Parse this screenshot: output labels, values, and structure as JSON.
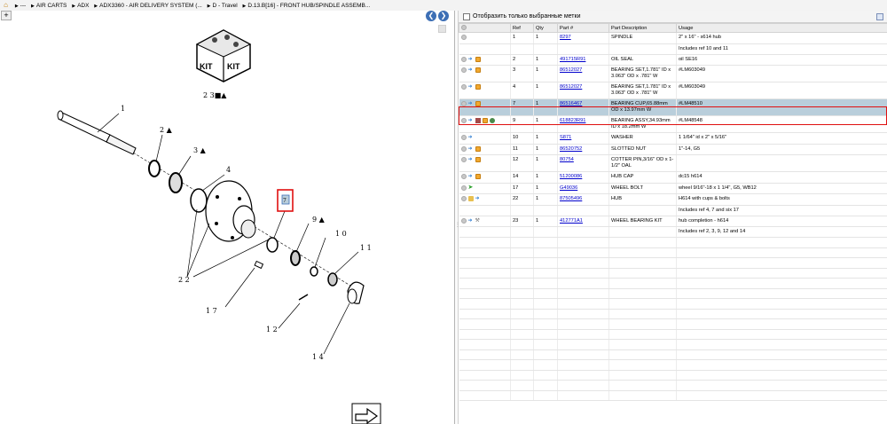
{
  "breadcrumb": {
    "items": [
      "---",
      "AIR CARTS",
      "ADX",
      "ADX3360 - AIR DELIVERY SYSTEM (...",
      "D - Travel",
      "D.13.B[16] - FRONT HUB/SPINDLE ASSEMB..."
    ]
  },
  "drawing": {
    "kit_label_1": "KIT",
    "kit_label_2": "KIT",
    "callouts": [
      {
        "id": "c23",
        "text": "2 3■▲"
      },
      {
        "id": "c1",
        "text": "1"
      },
      {
        "id": "c2",
        "text": "2 ▲"
      },
      {
        "id": "c3",
        "text": "3 ▲"
      },
      {
        "id": "c4",
        "text": "4"
      },
      {
        "id": "c7",
        "text": "7"
      },
      {
        "id": "c9",
        "text": "9 ▲"
      },
      {
        "id": "c10",
        "text": "1 0"
      },
      {
        "id": "c11",
        "text": "1 1"
      },
      {
        "id": "c22",
        "text": "2 2"
      },
      {
        "id": "c17",
        "text": "1 7"
      },
      {
        "id": "c12",
        "text": "1 2"
      },
      {
        "id": "c14",
        "text": "1 4"
      }
    ]
  },
  "right": {
    "filter_label": "Отобразить только выбранные метки",
    "columns": [
      "",
      "Ref",
      "Qty",
      "Part #",
      "Part Description",
      "Usage"
    ],
    "rows": [
      {
        "icons": [
          "circ"
        ],
        "ref": "1",
        "qty": "1",
        "part": "8297",
        "desc": "SPINDLE",
        "usage": "2\" x 16\" - s614 hub",
        "selected": false
      },
      {
        "icons": [],
        "ref": "",
        "qty": "",
        "part": "",
        "desc": "",
        "usage": "Includes ref 10 and 11",
        "selected": false
      },
      {
        "icons": [
          "circ",
          "arrow",
          "box"
        ],
        "ref": "2",
        "qty": "1",
        "part": "491715R91",
        "desc": "OIL SEAL",
        "usage": "oil SE16",
        "selected": false
      },
      {
        "icons": [
          "circ",
          "arrow",
          "box"
        ],
        "ref": "3",
        "qty": "1",
        "part": "86512027",
        "desc": "BEARING SET,1.781\" ID x 3.063\" OD x .781\" W",
        "usage": "#LM603049",
        "selected": false
      },
      {
        "icons": [
          "circ",
          "arrow",
          "box"
        ],
        "ref": "4",
        "qty": "1",
        "part": "86512027",
        "desc": "BEARING SET,1.781\" ID x 3.063\" OD x .781\" W",
        "usage": "#LM603049",
        "selected": false
      },
      {
        "icons": [
          "circ",
          "arrow",
          "box"
        ],
        "ref": "7",
        "qty": "1",
        "part": "86516467",
        "desc": "BEARING CUP,65.88mm OD x 13.97mm W",
        "usage": "#LM48510",
        "selected": true
      },
      {
        "icons": [
          "circ",
          "arrow",
          "doc",
          "box",
          "globe"
        ],
        "ref": "9",
        "qty": "1",
        "part": "618823R91",
        "desc": "BEARING ASSY,34.93mm ID x 18.2mm W",
        "usage": "#LM48548",
        "selected": false
      },
      {
        "icons": [
          "circ",
          "arrow"
        ],
        "ref": "10",
        "qty": "1",
        "part": "S871",
        "desc": "WASHER",
        "usage": "1 1/64\" id x 2\" x 5/16\"",
        "selected": false
      },
      {
        "icons": [
          "circ",
          "arrow",
          "box"
        ],
        "ref": "11",
        "qty": "1",
        "part": "86520752",
        "desc": "SLOTTED NUT",
        "usage": "1\"-14, G5",
        "selected": false
      },
      {
        "icons": [
          "circ",
          "arrow",
          "box"
        ],
        "ref": "12",
        "qty": "1",
        "part": "80754",
        "desc": "COTTER PIN,3/16\" OD x 1-1/2\" OAL",
        "usage": "",
        "selected": false
      },
      {
        "icons": [
          "circ",
          "arrow",
          "box"
        ],
        "ref": "14",
        "qty": "1",
        "part": "51200086",
        "desc": "HUB CAP",
        "usage": "dc15 h614",
        "selected": false
      },
      {
        "icons": [
          "circ",
          "green"
        ],
        "ref": "17",
        "qty": "1",
        "part": "G49036",
        "desc": "WHEEL BOLT",
        "usage": "wheel 9/16\"-18 x 1 1/4\", G5, WB12",
        "selected": false
      },
      {
        "icons": [
          "circ",
          "folder",
          "arrow"
        ],
        "ref": "22",
        "qty": "1",
        "part": "87505496",
        "desc": "HUB",
        "usage": "H614 with cups & bolts",
        "selected": false
      },
      {
        "icons": [],
        "ref": "",
        "qty": "",
        "part": "",
        "desc": "",
        "usage": "Includes ref 4, 7 and six 17",
        "selected": false
      },
      {
        "icons": [
          "circ",
          "arrow",
          "gear"
        ],
        "ref": "23",
        "qty": "1",
        "part": "412771A1",
        "desc": "WHEEL BEARING KIT",
        "usage": "hub completion - h614",
        "selected": false
      },
      {
        "icons": [],
        "ref": "",
        "qty": "",
        "part": "",
        "desc": "",
        "usage": "Includes ref 2, 3, 9, 12 and 14",
        "selected": false
      }
    ]
  },
  "colors": {
    "selection_fill": "#b9cedb",
    "highlight_border": "#e01010",
    "link": "#0000cc",
    "nav_button": "#3d6fb5"
  }
}
